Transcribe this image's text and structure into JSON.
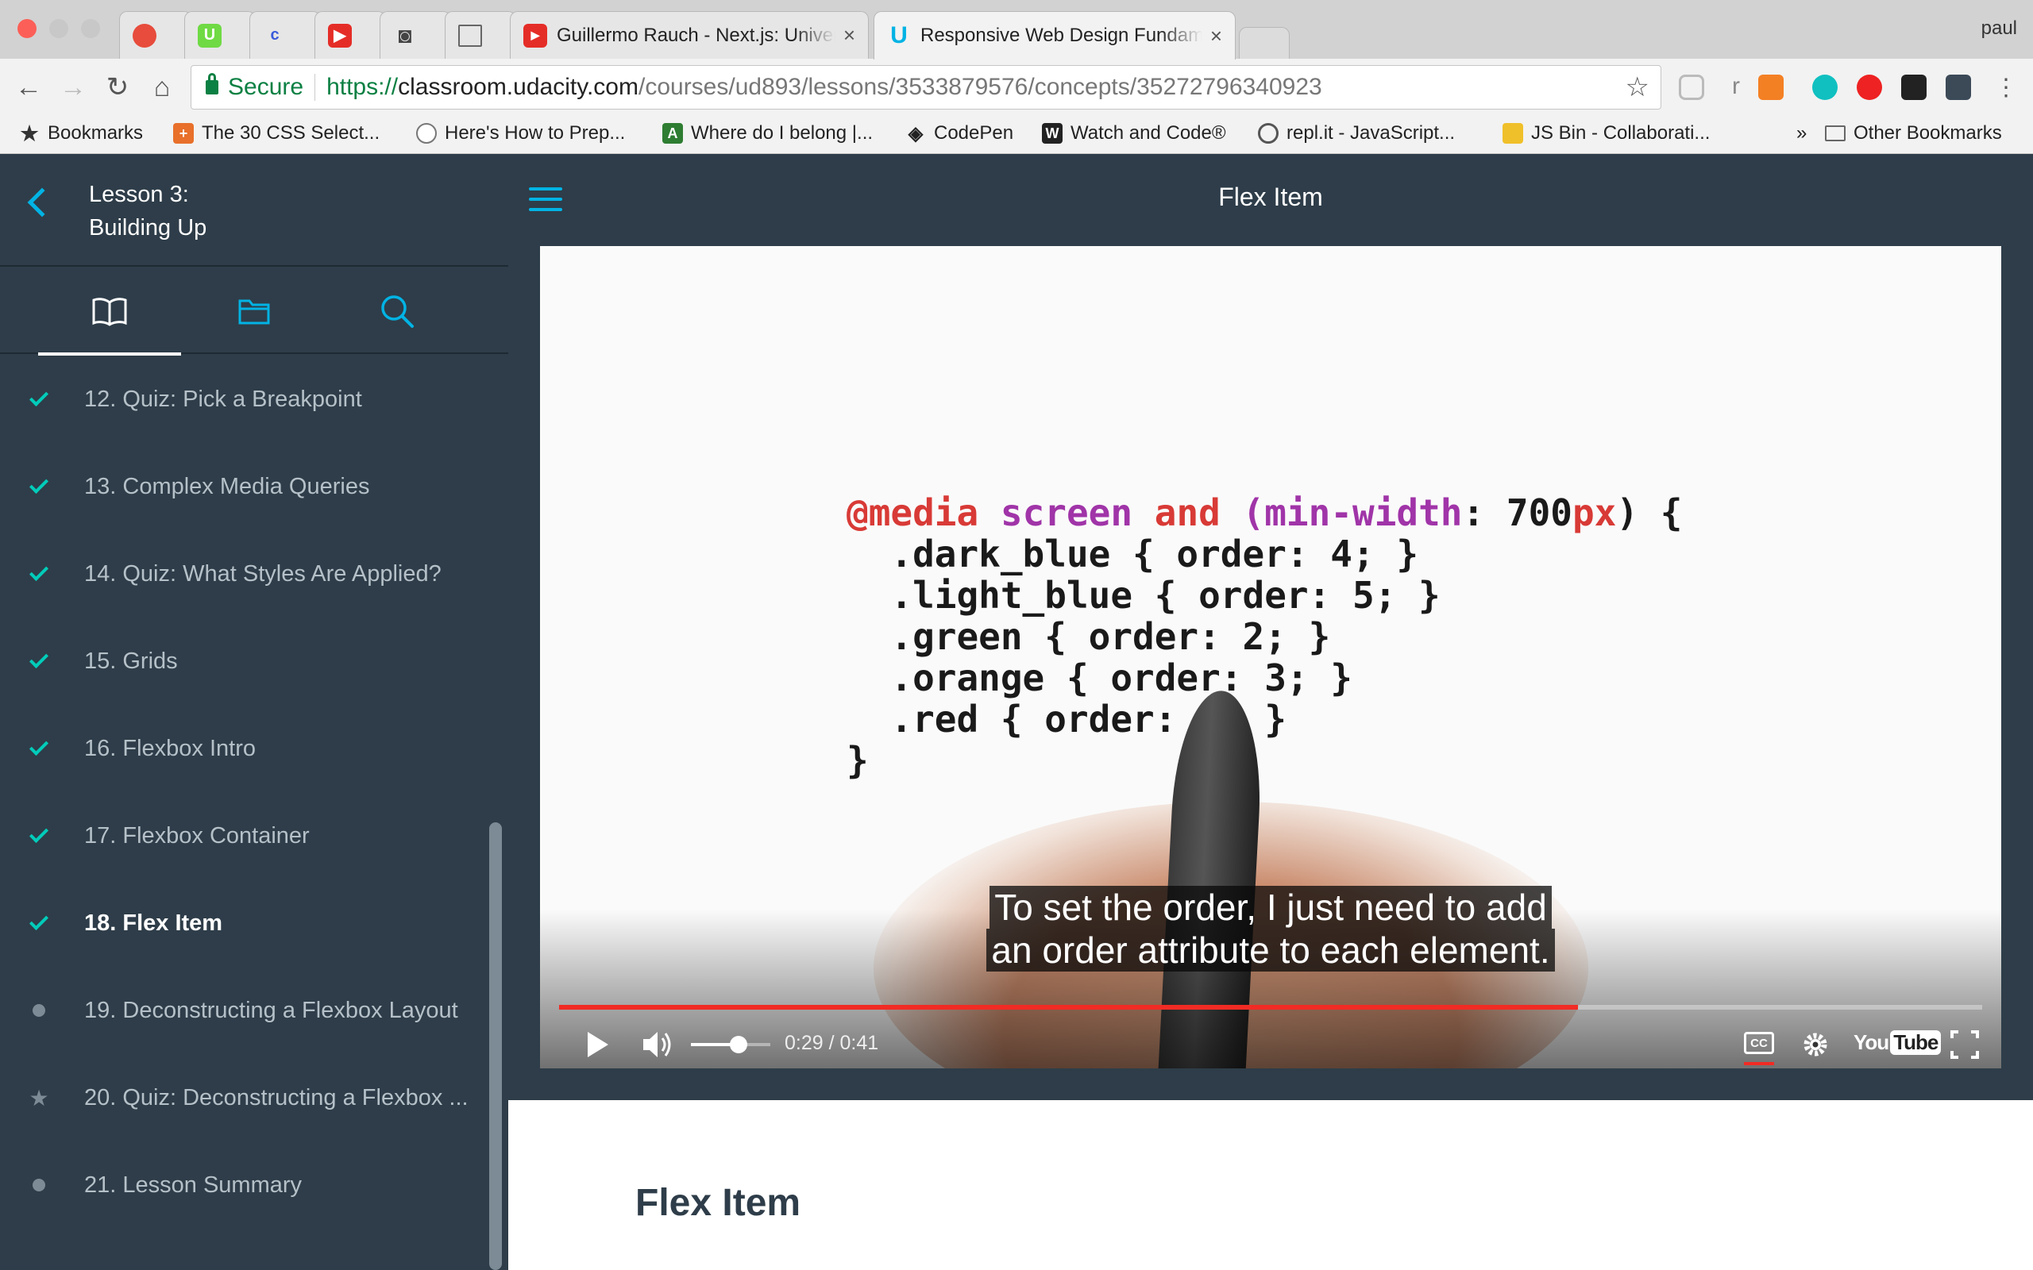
{
  "browser": {
    "profile": "paul",
    "tabs": [
      {
        "title": "",
        "icon": "pokeball-favicon"
      },
      {
        "title": "",
        "icon": "upwork-favicon"
      },
      {
        "title": "",
        "icon": "c-favicon"
      },
      {
        "title": "",
        "icon": "youtube-favicon"
      },
      {
        "title": "",
        "icon": "camera-favicon"
      },
      {
        "title": "",
        "icon": "document-favicon"
      },
      {
        "title": "Guillermo Rauch - Next.js: Universal",
        "icon": "youtube-favicon"
      },
      {
        "title": "Responsive Web Design Fundamentals",
        "icon": "udacity-favicon",
        "active": true
      }
    ],
    "url": {
      "secure_label": "Secure",
      "scheme": "https://",
      "host": "classroom.udacity.com",
      "path": "/courses/ud893/lessons/3533879576/concepts/35272796340923"
    },
    "bookmarks": [
      {
        "label": "Bookmarks",
        "icon": "star-icon"
      },
      {
        "label": "The 30 CSS Select...",
        "icon": "plus-icon"
      },
      {
        "label": "Here's How to Prep...",
        "icon": "reddit-icon"
      },
      {
        "label": "Where do I belong |...",
        "icon": "leaf-icon"
      },
      {
        "label": "CodePen",
        "icon": "codepen-icon"
      },
      {
        "label": "Watch and Code®",
        "icon": "w-icon"
      },
      {
        "label": "repl.it - JavaScript...",
        "icon": "replit-icon"
      },
      {
        "label": "JS Bin - Collaborati...",
        "icon": "jsbin-icon"
      },
      {
        "label": "»",
        "icon": ""
      },
      {
        "label": "Other Bookmarks",
        "icon": "folder-icon"
      }
    ]
  },
  "sidebar": {
    "lesson_line1": "Lesson 3:",
    "lesson_line2": "Building Up",
    "concepts": [
      {
        "label": "12. Quiz: Pick a Breakpoint",
        "status": "done"
      },
      {
        "label": "13. Complex Media Queries",
        "status": "done"
      },
      {
        "label": "14. Quiz: What Styles Are Applied?",
        "status": "done"
      },
      {
        "label": "15. Grids",
        "status": "done"
      },
      {
        "label": "16. Flexbox Intro",
        "status": "done"
      },
      {
        "label": "17. Flexbox Container",
        "status": "done"
      },
      {
        "label": "18. Flex Item",
        "status": "current"
      },
      {
        "label": "19. Deconstructing a Flexbox Layout",
        "status": "todo"
      },
      {
        "label": "20. Quiz: Deconstructing a Flexbox ...",
        "status": "quiz"
      },
      {
        "label": "21. Lesson Summary",
        "status": "todo"
      }
    ]
  },
  "header": {
    "title": "Flex Item"
  },
  "video": {
    "code": {
      "line1_kw": "@media",
      "line1_a": "screen",
      "line1_b": "and",
      "line1_c": "(min-width",
      "line1_d": ": 700",
      "line1_e": "px",
      "line1_f": ") {",
      "line2": "  .dark_blue { order: 4; }",
      "line3": "  .light_blue { order: 5; }",
      "line4": "  .green { order: 2; }",
      "line5": "  .orange { order: 3; }",
      "line6": "  .red { order: 1; }",
      "line7": "}"
    },
    "caption_line1": "To set the order, I just need to add",
    "caption_line2": "an order attribute to each element.",
    "time": "0:29 / 0:41",
    "progress": 0.716,
    "volume": 0.6,
    "cc_label": "CC",
    "youtube_label": "You",
    "youtube_label2": "Tube"
  },
  "content": {
    "heading": "Flex Item"
  },
  "colors": {
    "accent": "#02b3e4",
    "check": "#02ccba",
    "sidebar": "#2e3d49",
    "progress": "#f12b24"
  }
}
